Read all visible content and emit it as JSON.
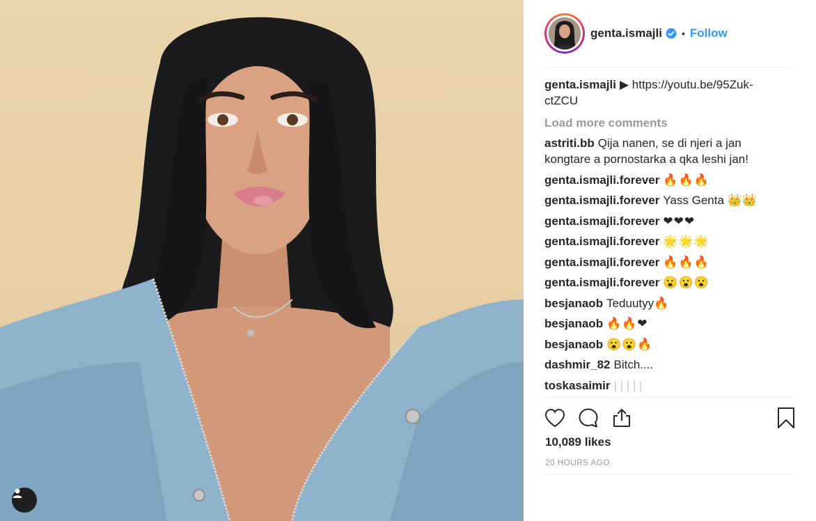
{
  "post": {
    "author": "genta.ismajli",
    "follow_label": "Follow",
    "separator": "•",
    "caption": {
      "username": "genta.ismajli",
      "text": "▶ https://youtu.be/95Zuk-ctZCU"
    },
    "load_more_label": "Load more comments",
    "comments": [
      {
        "username": "astriti.bb",
        "text": "Qija nanen, se di njeri a jan kongtare a pornostarka a qka leshi jan!"
      },
      {
        "username": "genta.ismajli.forever",
        "text": "🔥🔥🔥"
      },
      {
        "username": "genta.ismajli.forever",
        "text": "Yass Genta 👑👑"
      },
      {
        "username": "genta.ismajli.forever",
        "text": "❤❤❤"
      },
      {
        "username": "genta.ismajli.forever",
        "text": "🌟🌟🌟"
      },
      {
        "username": "genta.ismajli.forever",
        "text": "🔥🔥🔥"
      },
      {
        "username": "genta.ismajli.forever",
        "text": "😮😮😮"
      },
      {
        "username": "besjanaob",
        "text": "Teduutyy🔥"
      },
      {
        "username": "besjanaob",
        "text": "🔥🔥❤"
      },
      {
        "username": "besjanaob",
        "text": "😮😮🔥"
      },
      {
        "username": "dashmir_82",
        "text": "Bitch...."
      },
      {
        "username": "toskasaimir",
        "text": "| | | | |"
      }
    ],
    "likes": "10,089 likes",
    "timestamp": "20 HOURS AGO"
  },
  "icons": {
    "verified": "verified-badge-icon",
    "like": "heart-icon",
    "comment": "speech-bubble-icon",
    "share": "share-icon",
    "save": "bookmark-icon",
    "tag": "user-tag-icon"
  },
  "colors": {
    "link": "#3897f0",
    "text": "#262626",
    "muted": "#999999",
    "divider": "#efefef"
  }
}
